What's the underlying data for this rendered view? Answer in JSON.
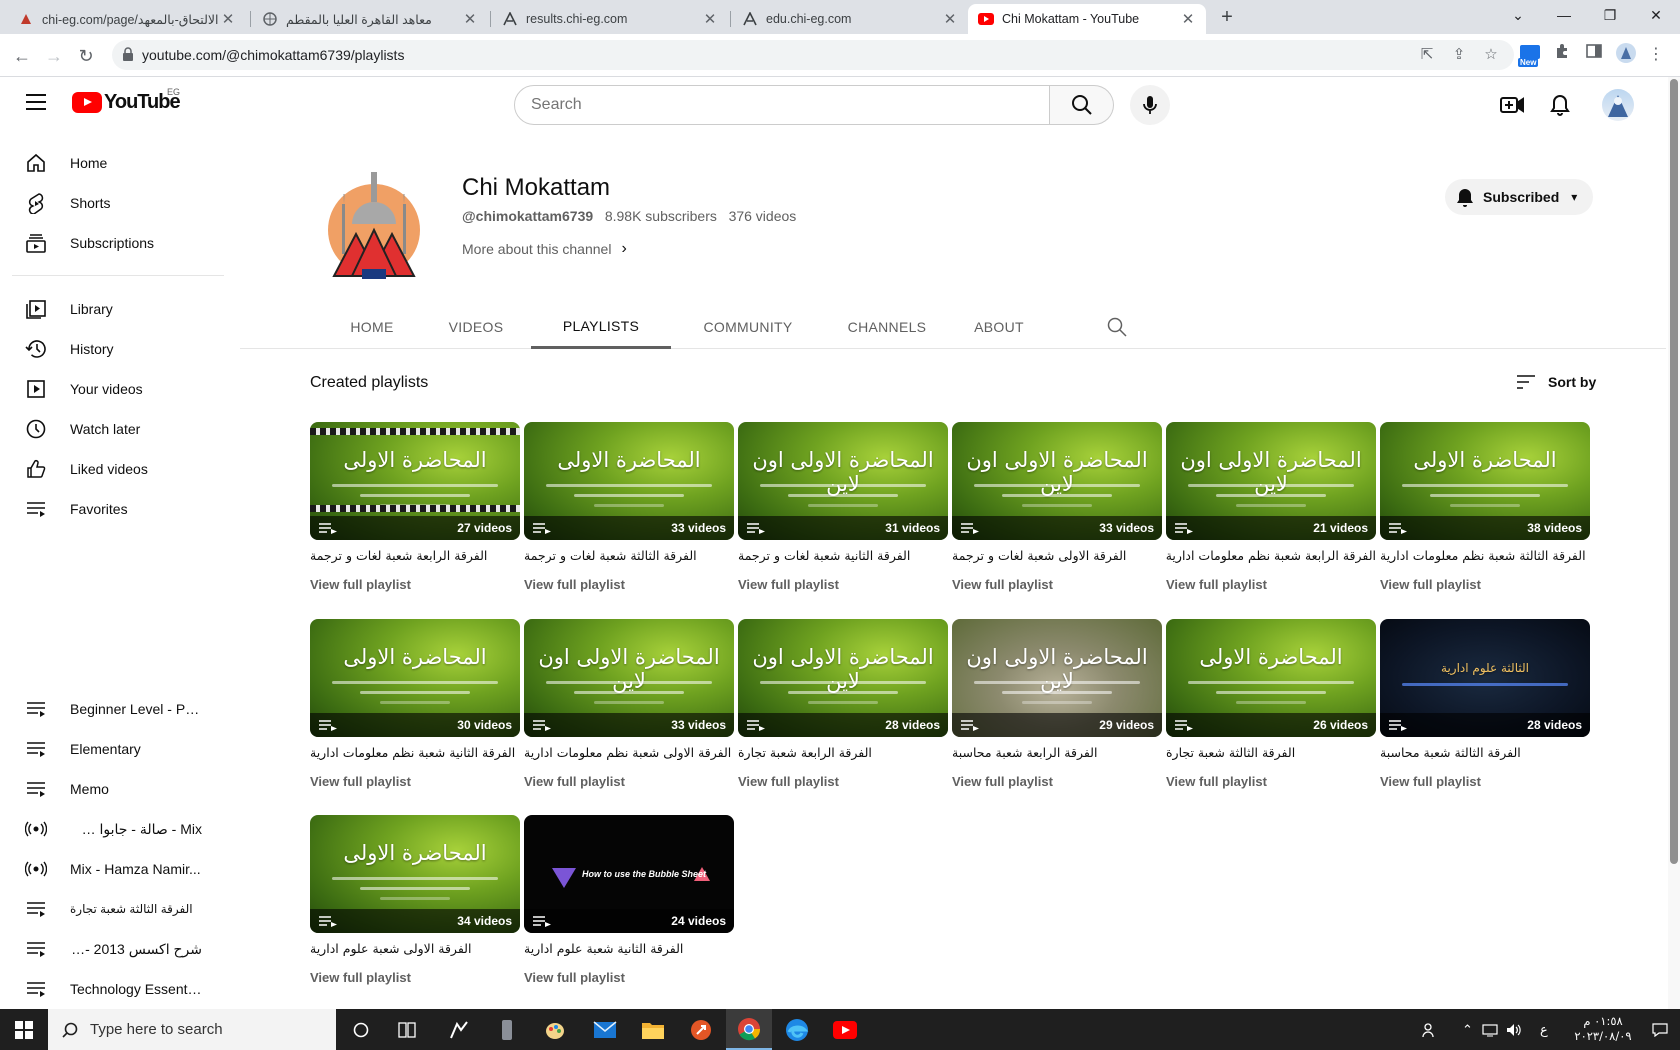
{
  "browser": {
    "tabs": [
      {
        "title": "الالتحاق-بالمعهد/chi-eg.com/page",
        "favicon": "chi-icon"
      },
      {
        "title": "معاهد القاهرة العليا بالمقطم",
        "favicon": "globe-icon"
      },
      {
        "title": "results.chi-eg.com",
        "favicon": "chi-a-icon"
      },
      {
        "title": "edu.chi-eg.com",
        "favicon": "chi-a-icon"
      },
      {
        "title": "Chi Mokattam - YouTube",
        "favicon": "youtube-icon",
        "active": true
      }
    ],
    "address": "youtube.com/@chimokattam6739/playlists",
    "new_badge": "New"
  },
  "masthead": {
    "logo_text": "YouTube",
    "country_code": "EG",
    "search_placeholder": "Search"
  },
  "sidebar": {
    "main": [
      {
        "label": "Home",
        "icon": "home-icon"
      },
      {
        "label": "Shorts",
        "icon": "shorts-icon"
      },
      {
        "label": "Subscriptions",
        "icon": "subscriptions-icon"
      }
    ],
    "you": [
      {
        "label": "Library",
        "icon": "library-icon"
      },
      {
        "label": "History",
        "icon": "history-icon"
      },
      {
        "label": "Your videos",
        "icon": "your-videos-icon"
      },
      {
        "label": "Watch later",
        "icon": "watch-later-icon"
      },
      {
        "label": "Liked videos",
        "icon": "liked-icon"
      },
      {
        "label": "Favorites",
        "icon": "playlist-icon"
      }
    ],
    "playlists": [
      {
        "label": "Beginner Level - Pra...",
        "icon": "playlist-icon"
      },
      {
        "label": "Elementary",
        "icon": "playlist-icon"
      },
      {
        "label": "Memo",
        "icon": "playlist-icon"
      },
      {
        "label": "Mix - صالة - جابوا سيرته...",
        "icon": "mix-icon"
      },
      {
        "label": "Mix - Hamza Namir...",
        "icon": "mix-icon"
      },
      {
        "label": "الفرقة الثالثة شعبة تجارة",
        "icon": "playlist-icon"
      },
      {
        "label": "شرح اكسس 2013 -2016...",
        "icon": "playlist-icon"
      },
      {
        "label": "Technology Essenti...",
        "icon": "playlist-icon"
      }
    ]
  },
  "channel": {
    "name": "Chi Mokattam",
    "handle": "@chimokattam6739",
    "subscribers": "8.98K subscribers",
    "videos": "376 videos",
    "more_about": "More about this channel",
    "subscribed_label": "Subscribed",
    "tabs": [
      "HOME",
      "VIDEOS",
      "PLAYLISTS",
      "COMMUNITY",
      "CHANNELS",
      "ABOUT"
    ],
    "active_tab": "PLAYLISTS"
  },
  "content": {
    "section_title": "Created playlists",
    "sort_label": "Sort by",
    "view_full": "View full playlist",
    "playlists": [
      {
        "title": "الفرقة الرابعة شعبة لغات و ترجمة",
        "count": "27 videos",
        "thumb_text": "المحاضرة الاولى",
        "style": "green-film"
      },
      {
        "title": "الفرقة الثالثة شعبة لغات و ترجمة",
        "count": "33 videos",
        "thumb_text": "المحاضرة الاولى",
        "style": "green"
      },
      {
        "title": "الفرقة الثانية شعبة لغات و ترجمة",
        "count": "31 videos",
        "thumb_text": "المحاضرة الاولى اون لاين",
        "style": "green"
      },
      {
        "title": "الفرقة الاولى شعبة لغات و ترجمة",
        "count": "33 videos",
        "thumb_text": "المحاضرة الاولى اون لاين",
        "style": "green"
      },
      {
        "title": "الفرقة الرابعة شعبة نظم معلومات ادارية",
        "count": "21 videos",
        "thumb_text": "المحاضرة الاولى اون لاين",
        "style": "green"
      },
      {
        "title": "الفرقة الثالثة شعبة نظم معلومات ادارية",
        "count": "38 videos",
        "thumb_text": "المحاضرة الاولى",
        "style": "green"
      },
      {
        "title": "الفرقة الثانية شعبة نظم معلومات ادارية",
        "count": "30 videos",
        "thumb_text": "المحاضرة الاولى",
        "style": "green"
      },
      {
        "title": "الفرقة الاولى شعبة نظم معلومات ادارية",
        "count": "33 videos",
        "thumb_text": "المحاضرة الاولى اون لاين",
        "style": "green"
      },
      {
        "title": "الفرقة الرابعة شعبة تجارة",
        "count": "28 videos",
        "thumb_text": "المحاضرة الاولى اون لاين",
        "style": "green"
      },
      {
        "title": "الفرقة الرابعة شعبة محاسبة",
        "count": "29 videos",
        "thumb_text": "المحاضرة الاولى اون لاين",
        "style": "photo"
      },
      {
        "title": "الفرقة الثالثة شعبة تجارة",
        "count": "26 videos",
        "thumb_text": "المحاضرة الاولى",
        "style": "green"
      },
      {
        "title": "الفرقة الثالثة شعبة محاسبة",
        "count": "28 videos",
        "thumb_text": "الثالثة علوم ادارية",
        "style": "dark"
      },
      {
        "title": "الفرقة الاولى شعبة علوم ادارية",
        "count": "34 videos",
        "thumb_text": "المحاضرة الاولى",
        "style": "green"
      },
      {
        "title": "الفرقة الثانية شعبة علوم ادارية",
        "count": "24 videos",
        "thumb_text": "How to use the Bubble Sheet",
        "style": "black"
      }
    ]
  },
  "taskbar": {
    "search_placeholder": "Type here to search",
    "lang": "ع",
    "time": "٠١:٥٨ م",
    "date": "٢٠٢٣/٠٨/٠٩"
  },
  "colors": {
    "youtube_red": "#ff0000",
    "tab_bar": "#dee1e6",
    "taskbar": "#1f1f1f"
  }
}
